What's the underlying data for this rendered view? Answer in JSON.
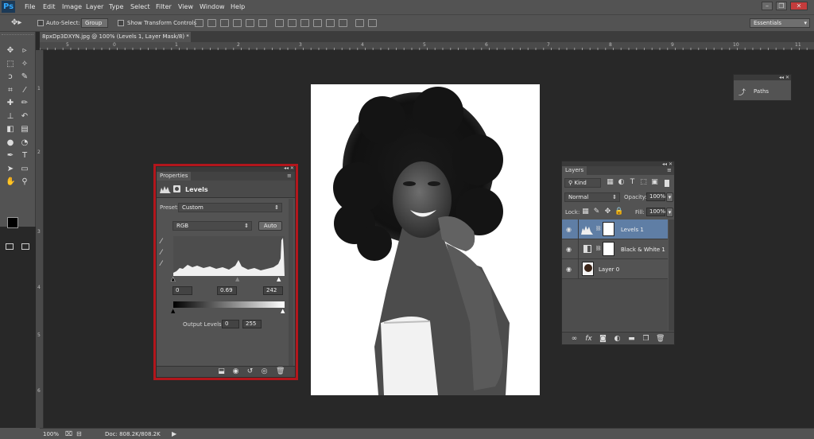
{
  "app": {
    "logo": "Ps",
    "workspace": "Essentials"
  },
  "menu": [
    "File",
    "Edit",
    "Image",
    "Layer",
    "Type",
    "Select",
    "Filter",
    "View",
    "Window",
    "Help"
  ],
  "window_controls": {
    "minimize": "–",
    "maximize": "❐",
    "close": "✕"
  },
  "options_bar": {
    "auto_select_label": "Auto-Select:",
    "auto_select_checked": false,
    "auto_select_value": "Group",
    "show_transform_label": "Show Transform Controls",
    "show_transform_checked": false
  },
  "document_tab": {
    "title": "8pxDp3DXYN.jpg @ 100% (Levels 1, Layer Mask/8) *",
    "close": "×"
  },
  "ruler_top": [
    "5",
    "0",
    "1",
    "2",
    "3",
    "4",
    "5",
    "6",
    "7",
    "8",
    "9",
    "10",
    "11",
    "12"
  ],
  "ruler_left": [
    "1",
    "2",
    "3",
    "4",
    "5",
    "6"
  ],
  "tools": [
    [
      "move-tool-icon",
      "✥"
    ],
    [
      "artboard-tool-icon",
      "▹"
    ],
    [
      "marquee-tool-icon",
      "⬚"
    ],
    [
      "magic-wand-icon",
      "✧"
    ],
    [
      "lasso-tool-icon",
      "ↄ"
    ],
    [
      "quick-select-icon",
      "✎"
    ],
    [
      "crop-tool-icon",
      "⌗"
    ],
    [
      "eyedropper-icon",
      "⁄"
    ],
    [
      "healing-brush-icon",
      "✚"
    ],
    [
      "brush-tool-icon",
      "✏"
    ],
    [
      "clone-stamp-icon",
      "⊥"
    ],
    [
      "history-brush-icon",
      "↶"
    ],
    [
      "eraser-tool-icon",
      "◧"
    ],
    [
      "gradient-tool-icon",
      "▤"
    ],
    [
      "blur-tool-icon",
      "●"
    ],
    [
      "dodge-tool-icon",
      "◔"
    ],
    [
      "pen-tool-icon",
      "✒"
    ],
    [
      "type-tool-icon",
      "T"
    ],
    [
      "path-select-icon",
      "➤"
    ],
    [
      "rectangle-tool-icon",
      "▭"
    ],
    [
      "hand-tool-icon",
      "✋"
    ],
    [
      "zoom-tool-icon",
      "⚲"
    ]
  ],
  "colors": {
    "foreground": "#000000",
    "background": "#ffffff",
    "highlight": "#b2161c",
    "selected_row": "#5f7ea5"
  },
  "status": {
    "zoom": "100%",
    "doc": "Doc: 808.2K/808.2K"
  },
  "paths_panel": {
    "label": "Paths"
  },
  "properties_panel": {
    "tab": "Properties",
    "title": "Levels",
    "preset_label": "Preset:",
    "preset_value": "Custom",
    "channel": "RGB",
    "auto_label": "Auto",
    "input_black": "0",
    "input_gamma": "0.69",
    "input_white": "242",
    "output_label": "Output Levels:",
    "output_black": "0",
    "output_white": "255"
  },
  "layers_panel": {
    "tab": "Layers",
    "kind_label": "Kind",
    "blend_mode": "Normal",
    "opacity_label": "Opacity:",
    "opacity_value": "100%",
    "lock_label": "Lock:",
    "fill_label": "Fill:",
    "fill_value": "100%",
    "layers": [
      {
        "name": "Levels 1",
        "selected": true
      },
      {
        "name": "Black & White 1",
        "selected": false
      },
      {
        "name": "Layer 0",
        "selected": false
      }
    ]
  }
}
